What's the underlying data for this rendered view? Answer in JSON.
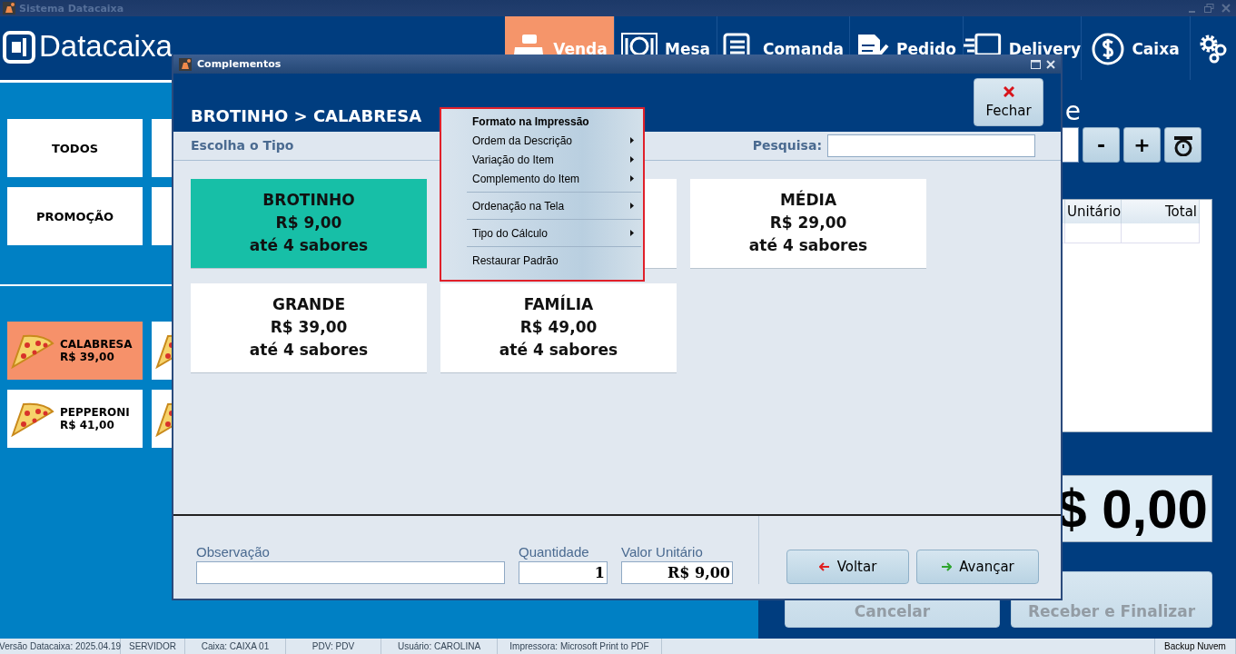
{
  "window": {
    "title": "Sistema Datacaixa"
  },
  "header": {
    "logo": "Datacaixa",
    "nav": [
      {
        "label": "Venda",
        "selected": true
      },
      {
        "label": "Mesa",
        "selected": false
      },
      {
        "label": "Comanda",
        "selected": false
      },
      {
        "label": "Pedido",
        "selected": false
      },
      {
        "label": "Delivery",
        "selected": false
      },
      {
        "label": "Caixa",
        "selected": false
      }
    ]
  },
  "categories": [
    {
      "kind": "tile",
      "label": "TODOS"
    },
    {
      "kind": "covered"
    },
    {
      "kind": "tile",
      "label": "PROMOÇÃO"
    },
    {
      "kind": "covered"
    }
  ],
  "products": [
    {
      "kind": "tile",
      "name": "CALABRESA",
      "price": "R$ 39,00",
      "selected": true
    },
    {
      "kind": "covered",
      "selected": false
    },
    {
      "kind": "tile",
      "name": "PEPPERONI",
      "price": "R$ 41,00",
      "selected": false
    },
    {
      "kind": "covered",
      "selected": false
    }
  ],
  "order_panel": {
    "heading": "e",
    "minus": "-",
    "plus": "+",
    "table": {
      "columns": [
        "Unitário",
        "Total"
      ]
    },
    "total": "$ 0,00",
    "buttons": [
      {
        "label": "Cancelar",
        "disabled": true
      },
      {
        "label": "Receber e Finalizar",
        "disabled": true
      }
    ]
  },
  "dialog": {
    "title": "Complementos",
    "breadcrumb": "BROTINHO > CALABRESA",
    "close_button": "Fechar",
    "section": "Escolha o Tipo",
    "search": {
      "label": "Pesquisa:"
    },
    "cards": [
      {
        "kind": "card",
        "name": "BROTINHO",
        "price": "R$ 9,00",
        "flavors": "até 4 sabores",
        "selected": true
      },
      {
        "kind": "covered",
        "selected": false
      },
      {
        "kind": "card",
        "name": "MÉDIA",
        "price": "R$ 29,00",
        "flavors": "até 4 sabores",
        "selected": false
      },
      {
        "kind": "card",
        "name": "GRANDE",
        "price": "R$ 39,00",
        "flavors": "até 4 sabores",
        "selected": false
      },
      {
        "kind": "card",
        "name": "FAMÍLIA",
        "price": "R$ 49,00",
        "flavors": "até 4 sabores",
        "selected": false
      }
    ],
    "observation": {
      "label": "Observação"
    },
    "quantity": {
      "label": "Quantidade",
      "value": "1"
    },
    "unit_price": {
      "label": "Valor Unitário",
      "value": "R$ 9,00"
    },
    "buttons": [
      {
        "label": "Voltar",
        "kind": "back"
      },
      {
        "label": "Avançar",
        "kind": "forward"
      }
    ]
  },
  "context_menu": {
    "items": [
      {
        "kind": "item",
        "label": "Formato na Impressão",
        "default": true,
        "submenu": false
      },
      {
        "kind": "item",
        "label": "Ordem da Descrição",
        "default": false,
        "submenu": true
      },
      {
        "kind": "item",
        "label": "Variação do Item",
        "default": false,
        "submenu": true
      },
      {
        "kind": "item",
        "label": "Complemento do Item",
        "default": false,
        "submenu": true
      },
      {
        "kind": "separator"
      },
      {
        "kind": "item",
        "label": "Ordenação na Tela",
        "default": false,
        "submenu": true
      },
      {
        "kind": "separator"
      },
      {
        "kind": "item",
        "label": "Tipo do Cálculo",
        "default": false,
        "submenu": true
      },
      {
        "kind": "separator"
      },
      {
        "kind": "item",
        "label": "Restaurar Padrão",
        "default": false,
        "submenu": false
      }
    ]
  },
  "status_bar": {
    "left": [
      "Versão Datacaixa: 2025.04.19",
      "SERVIDOR",
      "Caixa: CAIXA 01",
      "PDV: PDV",
      "Usuário: CAROLINA",
      "Impressora: Microsoft Print to PDF"
    ],
    "right": "Backup Nuvem"
  }
}
